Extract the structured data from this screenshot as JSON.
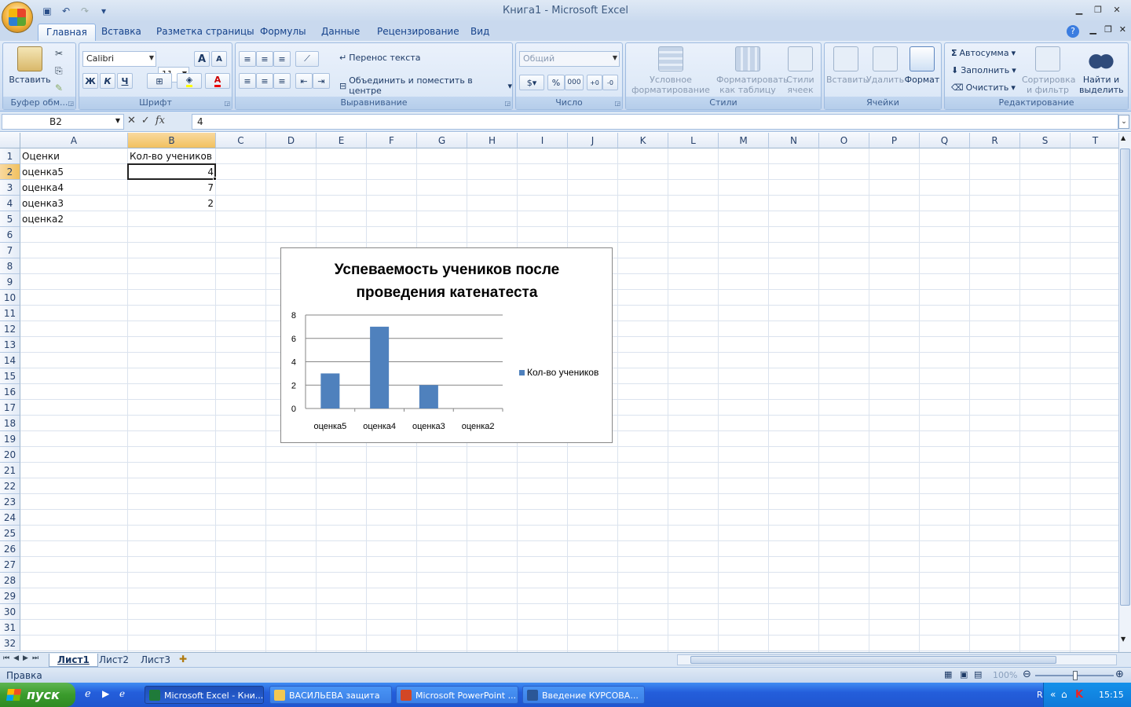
{
  "window": {
    "title": "Книга1 - Microsoft Excel"
  },
  "tabs": [
    "Главная",
    "Вставка",
    "Разметка страницы",
    "Формулы",
    "Данные",
    "Рецензирование",
    "Вид"
  ],
  "ribbon": {
    "clipboard": {
      "paste": "Вставить",
      "label": "Буфер обм..."
    },
    "font": {
      "name": "Calibri",
      "size": "11",
      "bold": "Ж",
      "italic": "К",
      "underline": "Ч",
      "font_color": "A",
      "grow": "A",
      "shrink": "A",
      "label": "Шрифт"
    },
    "alignment": {
      "wrap": "Перенос текста",
      "merge": "Объединить и поместить в центре",
      "label": "Выравнивание"
    },
    "number": {
      "format": "Общий",
      "percent": "%",
      "thousands": "000",
      "label": "Число"
    },
    "styles": {
      "conditional": "Условное форматирование",
      "as_table": "Форматировать как таблицу",
      "cell_styles": "Стили ячеек",
      "label": "Стили"
    },
    "cells": {
      "insert": "Вставить",
      "delete": "Удалить",
      "format": "Формат",
      "label": "Ячейки"
    },
    "editing": {
      "autosum": "Автосумма",
      "fill": "Заполнить",
      "clear": "Очистить",
      "sort": "Сортировка и фильтр",
      "find": "Найти и выделить",
      "label": "Редактирование"
    }
  },
  "formula_bar": {
    "name_box": "B2",
    "fx": "fx",
    "value": "4"
  },
  "grid": {
    "columns": [
      "A",
      "B",
      "C",
      "D",
      "E",
      "F",
      "G",
      "H",
      "I",
      "J",
      "K",
      "L",
      "M",
      "N",
      "O",
      "P",
      "Q",
      "R",
      "S",
      "T"
    ],
    "rows": [
      "1",
      "2",
      "3",
      "4",
      "5",
      "6",
      "7",
      "8",
      "9",
      "10",
      "11",
      "12",
      "13",
      "14",
      "15",
      "16",
      "17",
      "18",
      "19",
      "20",
      "21",
      "22",
      "23",
      "24",
      "25",
      "26",
      "27",
      "28",
      "29",
      "30",
      "31",
      "32"
    ],
    "cells": {
      "A1": "Оценки",
      "B1": "Кол-во учеников",
      "A2": "оценка5",
      "B2": "4",
      "A3": "оценка4",
      "B3": "7",
      "A4": "оценка3",
      "B4": "2",
      "A5": "оценка2"
    }
  },
  "chart_data": {
    "type": "bar",
    "title": "Успеваемость учеников после проведения катенатеста",
    "categories": [
      "оценка5",
      "оценка4",
      "оценка3",
      "оценка2"
    ],
    "series": [
      {
        "name": "Кол-во учеников",
        "values": [
          3,
          7,
          2,
          null
        ],
        "color": "#4f81bd"
      }
    ],
    "ylim": [
      0,
      8
    ],
    "yticks": [
      "0",
      "2",
      "4",
      "6",
      "8"
    ],
    "grid": true,
    "legend": "right"
  },
  "sheets": {
    "tabs": [
      "Лист1",
      "Лист2",
      "Лист3"
    ],
    "active": "Лист1"
  },
  "status": {
    "mode": "Правка",
    "zoom": "100%"
  },
  "taskbar": {
    "start": "пуск",
    "buttons": [
      "Microsoft Excel - Кни...",
      "ВАСИЛЬЕВА защита",
      "Microsoft PowerPoint ...",
      "Введение КУРСОВА..."
    ],
    "lang": "RL",
    "time": "15:15"
  }
}
